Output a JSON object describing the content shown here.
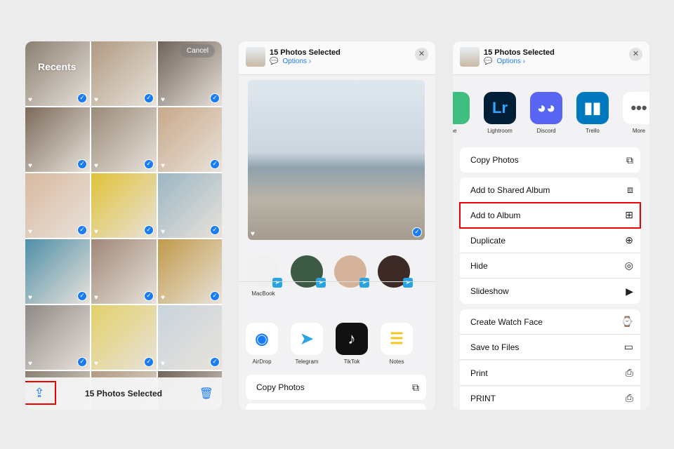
{
  "left": {
    "title": "Recents",
    "cancel": "Cancel",
    "selected": "15 Photos Selected",
    "photo_count": 15
  },
  "sheet": {
    "title": "15 Photos Selected",
    "options": "Options ›"
  },
  "mid": {
    "people": [
      {
        "name": "MacBook"
      },
      {
        "name": ""
      },
      {
        "name": ""
      },
      {
        "name": ""
      }
    ],
    "apps": [
      {
        "name": "AirDrop",
        "icon": "airdrop-icon"
      },
      {
        "name": "Telegram",
        "icon": "telegram-icon"
      },
      {
        "name": "TikTok",
        "icon": "tiktok-icon"
      },
      {
        "name": "Notes",
        "icon": "notes-icon"
      }
    ],
    "copy": "Copy Photos"
  },
  "right": {
    "apps": [
      {
        "name": "ne"
      },
      {
        "name": "Lightroom",
        "glyph": "Lr"
      },
      {
        "name": "Discord",
        "glyph": "◕◕"
      },
      {
        "name": "Trello",
        "glyph": "▮▮"
      },
      {
        "name": "More",
        "glyph": "•••"
      }
    ],
    "actions": [
      {
        "label": "Copy Photos",
        "icon": "⧉"
      },
      {
        "label": "Add to Shared Album",
        "icon": "⧈"
      },
      {
        "label": "Add to Album",
        "icon": "⊞"
      },
      {
        "label": "Duplicate",
        "icon": "⊕"
      },
      {
        "label": "Hide",
        "icon": "◎"
      },
      {
        "label": "Slideshow",
        "icon": "▶"
      },
      {
        "label": "Create Watch Face",
        "icon": "⌚"
      },
      {
        "label": "Save to Files",
        "icon": "▭"
      },
      {
        "label": "Print",
        "icon": "⎙"
      },
      {
        "label": "PRINT",
        "icon": "⎙"
      }
    ]
  }
}
